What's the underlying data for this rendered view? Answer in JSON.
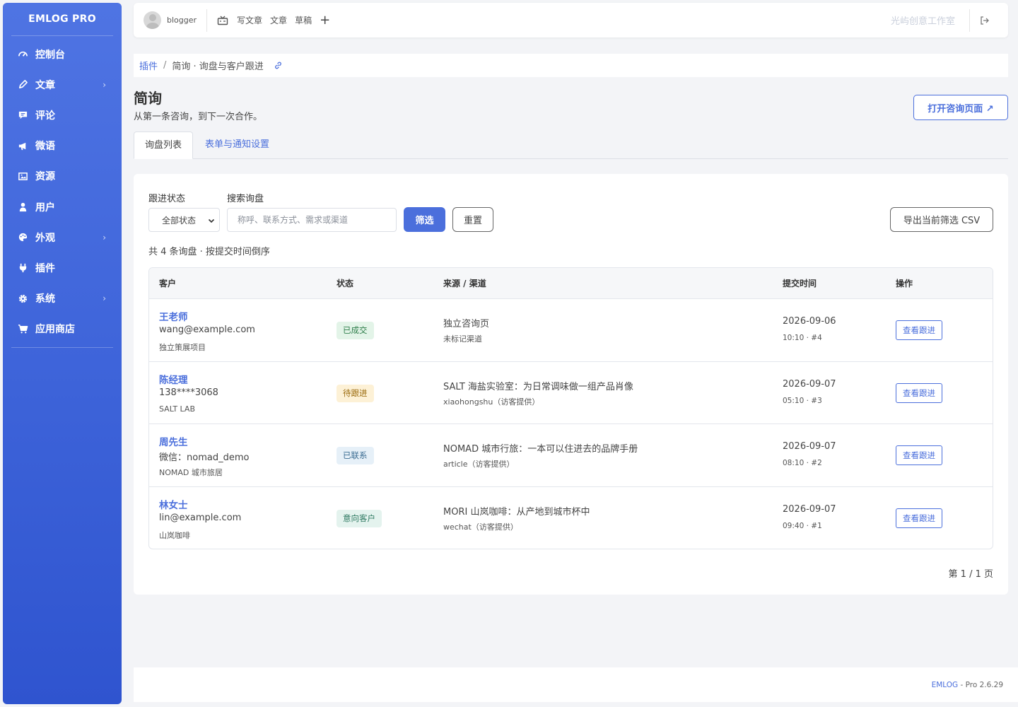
{
  "sidebar": {
    "brand": "EMLOG PRO",
    "items": [
      {
        "label": "控制台",
        "icon": "dashboard-icon",
        "has_sub": false
      },
      {
        "label": "文章",
        "icon": "pencil-icon",
        "has_sub": true
      },
      {
        "label": "评论",
        "icon": "comment-icon",
        "has_sub": false
      },
      {
        "label": "微语",
        "icon": "megaphone-icon",
        "has_sub": false
      },
      {
        "label": "资源",
        "icon": "image-icon",
        "has_sub": false
      },
      {
        "label": "用户",
        "icon": "user-icon",
        "has_sub": false
      },
      {
        "label": "外观",
        "icon": "palette-icon",
        "has_sub": true
      },
      {
        "label": "插件",
        "icon": "plug-icon",
        "has_sub": false
      },
      {
        "label": "系统",
        "icon": "gear-icon",
        "has_sub": true
      },
      {
        "label": "应用商店",
        "icon": "cart-icon",
        "has_sub": false
      }
    ],
    "chevron": "›"
  },
  "topbar": {
    "username": "blogger",
    "write": "写文章",
    "articles": "文章",
    "drafts": "草稿",
    "plus": "+",
    "site_name": "光屿创意工作室"
  },
  "breadcrumb": {
    "root": "插件",
    "sep": "/",
    "current": "简询 · 询盘与客户跟进"
  },
  "page": {
    "title": "简询",
    "subtitle": "从第一条咨询，到下一次合作。",
    "open_button": "打开咨询页面 ↗"
  },
  "tabs": {
    "list": "询盘列表",
    "settings": "表单与通知设置"
  },
  "filters": {
    "status_label": "跟进状态",
    "status_value": "全部状态",
    "search_label": "搜索询盘",
    "search_placeholder": "称呼、联系方式、需求或渠道",
    "filter_button": "筛选",
    "reset_button": "重置",
    "export_button": "导出当前筛选 CSV"
  },
  "summary": "共 4 条询盘 · 按提交时间倒序",
  "table": {
    "headers": {
      "customer": "客户",
      "status": "状态",
      "source": "来源 / 渠道",
      "time": "提交时间",
      "action": "操作"
    },
    "rows": [
      {
        "name": "王老师",
        "contact": "wang@example.com",
        "org": "独立策展项目",
        "status": "已成交",
        "source": "独立咨询页",
        "channel": "未标记渠道",
        "date": "2026-09-06",
        "meta": "10:10 · #4",
        "action": "查看跟进"
      },
      {
        "name": "陈经理",
        "contact": "138****3068",
        "org": "SALT LAB",
        "status": "待跟进",
        "source": "SALT 海盐实验室：为日常调味做一组产品肖像",
        "channel": "xiaohongshu（访客提供）",
        "date": "2026-09-07",
        "meta": "05:10 · #3",
        "action": "查看跟进"
      },
      {
        "name": "周先生",
        "contact": "微信：nomad_demo",
        "org": "NOMAD 城市旅居",
        "status": "已联系",
        "source": "NOMAD 城市行旅：一本可以住进去的品牌手册",
        "channel": "article（访客提供）",
        "date": "2026-09-07",
        "meta": "08:10 · #2",
        "action": "查看跟进"
      },
      {
        "name": "林女士",
        "contact": "lin@example.com",
        "org": "山岚咖啡",
        "status": "意向客户",
        "source": "MORI 山岚咖啡：从产地到城市杯中",
        "channel": "wechat（访客提供）",
        "date": "2026-09-07",
        "meta": "09:40 · #1",
        "action": "查看跟进"
      }
    ]
  },
  "pager": "第 1 / 1 页",
  "footer": {
    "brand": "EMLOG",
    "version": " - Pro 2.6.29"
  },
  "colors": {
    "accent": "#4b6fdc",
    "badge_done_bg": "#e3f4e8",
    "badge_done_fg": "#2e7d4a",
    "badge_pending_bg": "#fdf1d6",
    "badge_pending_fg": "#9a6a0c",
    "badge_contacted_bg": "#e6f0f8",
    "badge_contacted_fg": "#3b6c92",
    "badge_intent_bg": "#e4f3ee",
    "badge_intent_fg": "#2f7a62"
  }
}
